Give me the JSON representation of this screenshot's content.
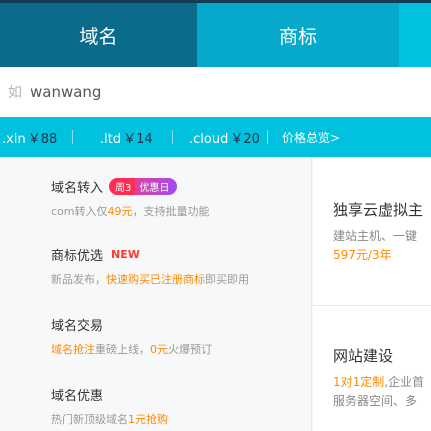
{
  "tabs": {
    "domain": "域名",
    "trademark": "商标"
  },
  "search": {
    "hint": "如",
    "placeholder": "wanwang"
  },
  "prices": [
    {
      "suffix": ".xin",
      "price": "￥88"
    },
    {
      "suffix": ".ltd",
      "price": "￥14"
    },
    {
      "suffix": ".cloud",
      "price": "￥20"
    }
  ],
  "price_overview": "价格总览>",
  "services": [
    {
      "title": "域名转入",
      "badge_week": "周3",
      "badge_text": "优惠日",
      "desc_a": "com转入仅",
      "desc_highlight": "49元",
      "desc_b": "，支持批量功能"
    },
    {
      "title": "商标优选",
      "badge_new": "NEW",
      "desc_a": "新品发布，",
      "desc_highlight": "快速购买已注册商标",
      "desc_b": "即买即用"
    },
    {
      "title": "域名交易",
      "desc_highlight": "域名抢注",
      "desc_a": "重磅上线，",
      "desc_highlight2": "0元",
      "desc_b": "火爆预订"
    },
    {
      "title": "域名优惠",
      "desc_a": "热门新顶级域名",
      "desc_highlight": "1元抢购"
    }
  ],
  "promos": [
    {
      "title": "独享云虚拟主",
      "line": "建站主机、一键",
      "price": "597元/3年"
    },
    {
      "title": "网站建设",
      "line_highlight": "1对1定制",
      "line_rest": ",企业首",
      "line2": "服务器空间、多"
    }
  ],
  "colors": {
    "brand_cyan": "#00c1de",
    "active_tab": "#0a6b8a",
    "highlight_orange": "#ff8a00",
    "new_red": "#ff3b30"
  }
}
